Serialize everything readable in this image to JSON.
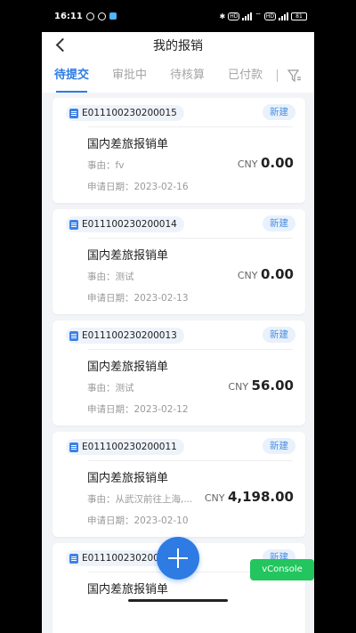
{
  "status": {
    "time": "16:11",
    "battery": "81"
  },
  "nav": {
    "title": "我的报销"
  },
  "tabs": [
    {
      "label": "待提交"
    },
    {
      "label": "审批中"
    },
    {
      "label": "待核算"
    },
    {
      "label": "已付款"
    }
  ],
  "cards": [
    {
      "code": "E011100230200015",
      "status": "新建",
      "type": "国内差旅报销单",
      "reason": "事由：fv",
      "date": "申请日期：2023-02-16",
      "currency": "CNY",
      "amount": "0.00"
    },
    {
      "code": "E011100230200014",
      "status": "新建",
      "type": "国内差旅报销单",
      "reason": "事由：测试",
      "date": "申请日期：2023-02-13",
      "currency": "CNY",
      "amount": "0.00"
    },
    {
      "code": "E011100230200013",
      "status": "新建",
      "type": "国内差旅报销单",
      "reason": "事由：测试",
      "date": "申请日期：2023-02-12",
      "currency": "CNY",
      "amount": "56.00"
    },
    {
      "code": "E011100230200011",
      "status": "新建",
      "type": "国内差旅报销单",
      "reason": "事由：从武汉前往上海,...",
      "date": "申请日期：2023-02-10",
      "currency": "CNY",
      "amount": "4,198.00"
    },
    {
      "code": "E0111002302000",
      "status": "新建",
      "type": "国内差旅报销单",
      "reason": "",
      "date": "",
      "currency": "",
      "amount": ""
    }
  ],
  "vconsole": "vConsole",
  "colors": {
    "accent": "#2d7be3",
    "badge_bg": "#e8f1fc",
    "vconsole": "#22c55e"
  }
}
